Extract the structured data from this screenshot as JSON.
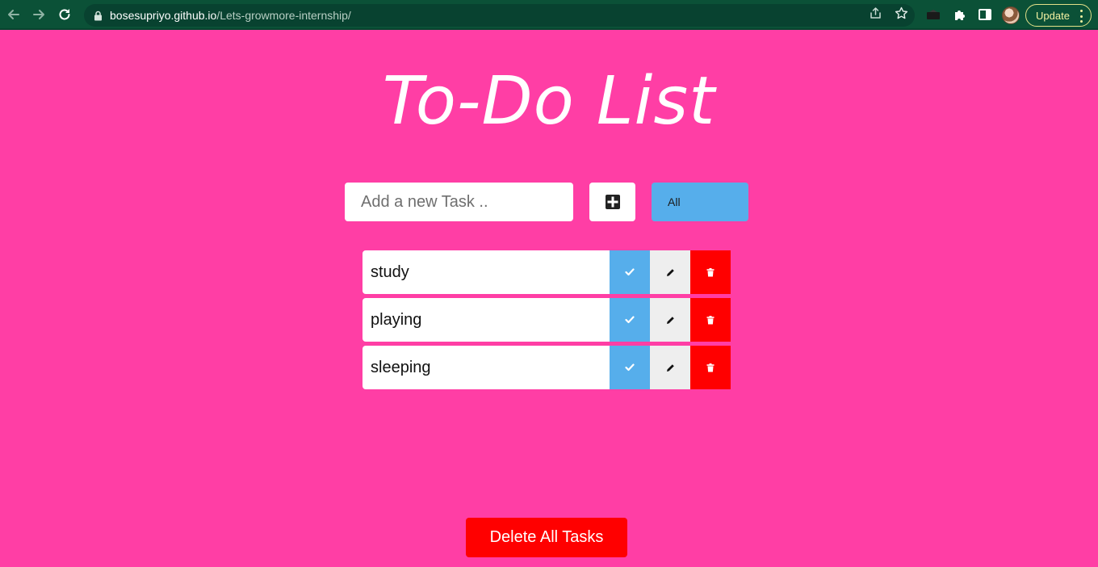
{
  "browser": {
    "url_host": "bosesupriyo.github.io",
    "url_path": "/Lets-growmore-internship/",
    "update_label": "Update",
    "icons": [
      "back-icon",
      "forward-icon",
      "reload-icon",
      "lock-icon",
      "share-icon",
      "star-icon",
      "extension-icon",
      "puzzle-icon",
      "sidepanel-icon",
      "avatar",
      "more-icon"
    ]
  },
  "page": {
    "title": "To-Do List",
    "input_placeholder": "Add a new Task ..",
    "add_icon": "plus-square-icon",
    "filter_selected": "All",
    "tasks": [
      {
        "text": "study"
      },
      {
        "text": "playing"
      },
      {
        "text": "sleeping"
      }
    ],
    "delete_all_label": "Delete All Tasks"
  },
  "colors": {
    "background": "#ff3ea5",
    "accent_blue": "#56aeeb",
    "danger_red": "#ff0000",
    "chrome_green": "#0b5137"
  }
}
